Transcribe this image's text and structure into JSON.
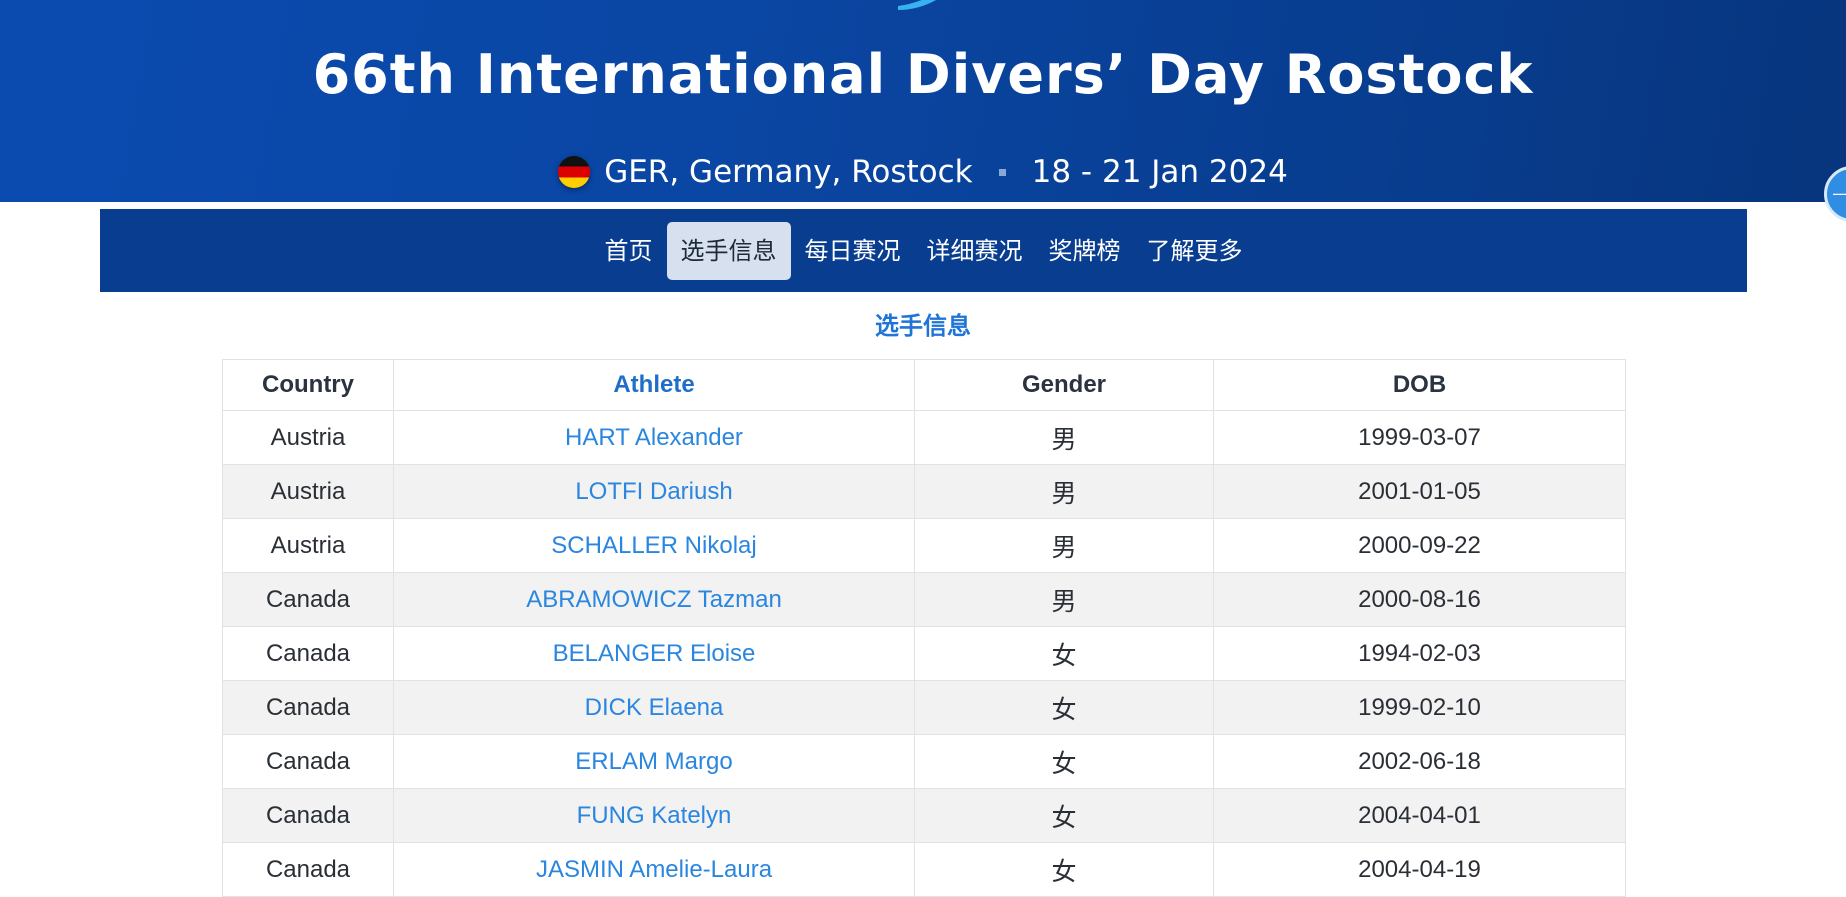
{
  "event": {
    "title": "66th International Divers’ Day Rostock",
    "location": "GER, Germany, Rostock",
    "dates": "18 - 21 Jan 2024"
  },
  "nav": {
    "items": [
      {
        "label": "首页",
        "active": false
      },
      {
        "label": "选手信息",
        "active": true
      },
      {
        "label": "每日赛况",
        "active": false
      },
      {
        "label": "详细赛况",
        "active": false
      },
      {
        "label": "奖牌榜",
        "active": false
      },
      {
        "label": "了解更多",
        "active": false
      }
    ]
  },
  "section": {
    "title": "选手信息"
  },
  "table": {
    "columns": [
      "Country",
      "Athlete",
      "Gender",
      "DOB"
    ],
    "rows": [
      {
        "country": "Austria",
        "athlete": "HART Alexander",
        "gender": "男",
        "dob": "1999-03-07"
      },
      {
        "country": "Austria",
        "athlete": "LOTFI Dariush",
        "gender": "男",
        "dob": "2001-01-05"
      },
      {
        "country": "Austria",
        "athlete": "SCHALLER Nikolaj",
        "gender": "男",
        "dob": "2000-09-22"
      },
      {
        "country": "Canada",
        "athlete": "ABRAMOWICZ Tazman",
        "gender": "男",
        "dob": "2000-08-16"
      },
      {
        "country": "Canada",
        "athlete": "BELANGER Eloise",
        "gender": "女",
        "dob": "1994-02-03"
      },
      {
        "country": "Canada",
        "athlete": "DICK Elaena",
        "gender": "女",
        "dob": "1999-02-10"
      },
      {
        "country": "Canada",
        "athlete": "ERLAM Margo",
        "gender": "女",
        "dob": "2002-06-18"
      },
      {
        "country": "Canada",
        "athlete": "FUNG Katelyn",
        "gender": "女",
        "dob": "2004-04-01"
      },
      {
        "country": "Canada",
        "athlete": "JASMIN Amelie-Laura",
        "gender": "女",
        "dob": "2004-04-19"
      }
    ]
  },
  "icons": {
    "flag": "germany-flag-icon",
    "scroll": "scroll-button-icon",
    "logo": "event-logo-icon"
  },
  "colors": {
    "banner": "#0a46a3",
    "nav": "#083d8f",
    "accent": "#1f74d6",
    "link": "#2a86de"
  }
}
